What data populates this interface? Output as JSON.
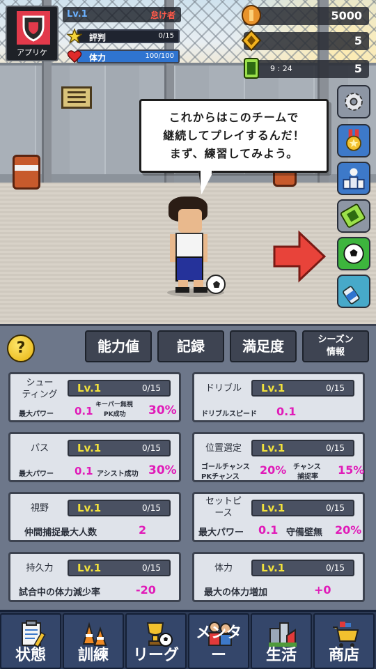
{
  "hud": {
    "team_name": "アプリケ",
    "level": "Lv.1",
    "trait": "怠け者",
    "reputation": {
      "label": "評判",
      "value": "0/15",
      "fill": 0
    },
    "stamina": {
      "label": "体力",
      "value": "100/100",
      "fill": 1.0
    },
    "coins": "5000",
    "gems": "5",
    "ticket_timer": "9 : 24",
    "tickets": "5"
  },
  "dialog": {
    "lines": [
      "これからはこのチームで",
      "継続してプレイするんだ！",
      "まず、練習してみよう。"
    ]
  },
  "side_buttons": [
    "gear-icon",
    "medal-icon",
    "podium-icon",
    "ticket-icon",
    "soccer-ball-icon",
    "drink-icon"
  ],
  "tabs": {
    "help": "?",
    "ability": "能力値",
    "record": "記録",
    "satisfaction": "満足度",
    "season_line1": "シーズン",
    "season_line2": "情報"
  },
  "cards": {
    "shooting": {
      "title_line1": "シュー",
      "title_line2": "ティング",
      "level": "Lv.1",
      "progress": "0/15",
      "stat1_label": "最大パワー",
      "stat1_value": "0.1",
      "stat2_label_line1": "キーパー無視",
      "stat2_label_line2": "PK成功",
      "stat2_value": "30%"
    },
    "dribble": {
      "title": "ドリブル",
      "level": "Lv.1",
      "progress": "0/15",
      "stat1_label": "ドリブルスピード",
      "stat1_value": "0.1"
    },
    "pass": {
      "title": "パス",
      "level": "Lv.1",
      "progress": "0/15",
      "stat1_label": "最大パワー",
      "stat1_value": "0.1",
      "stat2_label": "アシスト成功",
      "stat2_value": "30%"
    },
    "positioning": {
      "title": "位置選定",
      "level": "Lv.1",
      "progress": "0/15",
      "stat1_label_line1": "ゴールチャンス",
      "stat1_label_line2": "PKチャンス",
      "stat1_value": "20%",
      "stat2_label_line1": "チャンス",
      "stat2_label_line2": "捕捉率",
      "stat2_value": "15%"
    },
    "vision": {
      "title": "視野",
      "level": "Lv.1",
      "progress": "0/15",
      "stat1_label": "仲間捕捉最大人数",
      "stat1_value": "2"
    },
    "setpiece": {
      "title_line1": "セットピ",
      "title_line2": "ース",
      "level": "Lv.1",
      "progress": "0/15",
      "stat1_label": "最大パワー",
      "stat1_value": "0.1",
      "stat2_label": "守備壁無",
      "stat2_value": "20%"
    },
    "endurance": {
      "title": "持久力",
      "level": "Lv.1",
      "progress": "0/15",
      "stat1_label": "試合中の体力減少率",
      "stat1_value": "-20"
    },
    "stamina": {
      "title": "体力",
      "level": "Lv.1",
      "progress": "0/15",
      "stat1_label": "最大の体力増加",
      "stat1_value": "+0"
    }
  },
  "nav": [
    {
      "label": "状態",
      "icon": "clipboard-icon"
    },
    {
      "label": "訓練",
      "icon": "cones-icon"
    },
    {
      "label": "リーグ",
      "icon": "trophy-icon"
    },
    {
      "label": "メンター",
      "icon": "mentor-icon"
    },
    {
      "label": "生活",
      "icon": "town-icon"
    },
    {
      "label": "商店",
      "icon": "cart-icon"
    }
  ],
  "colors": {
    "accent_pink": "#e01bb8",
    "level_yellow": "#f2e23b",
    "nav_bg": "#2d3b56",
    "panel_bg": "#6d778a"
  }
}
